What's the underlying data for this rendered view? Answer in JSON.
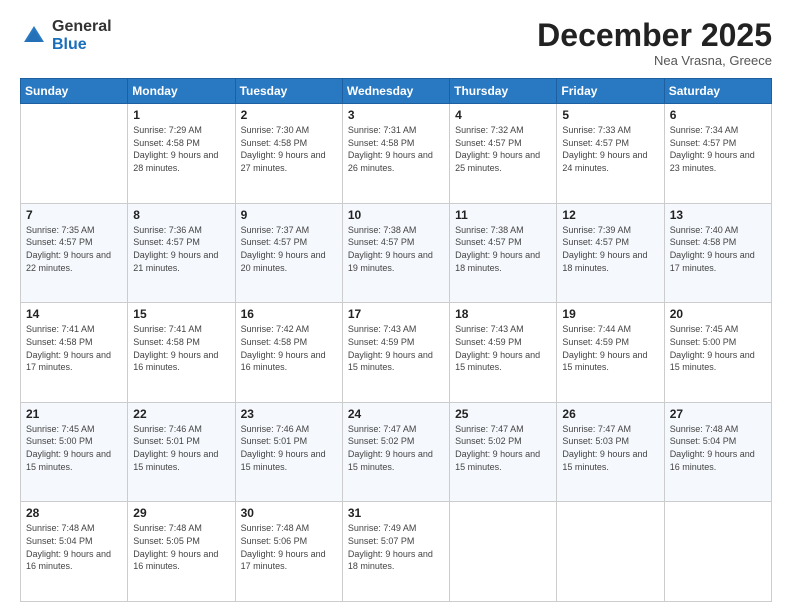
{
  "logo": {
    "general": "General",
    "blue": "Blue"
  },
  "header": {
    "month": "December 2025",
    "location": "Nea Vrasna, Greece"
  },
  "weekdays": [
    "Sunday",
    "Monday",
    "Tuesday",
    "Wednesday",
    "Thursday",
    "Friday",
    "Saturday"
  ],
  "weeks": [
    [
      {
        "day": "",
        "sunrise": "",
        "sunset": "",
        "daylight": ""
      },
      {
        "day": "1",
        "sunrise": "Sunrise: 7:29 AM",
        "sunset": "Sunset: 4:58 PM",
        "daylight": "Daylight: 9 hours and 28 minutes."
      },
      {
        "day": "2",
        "sunrise": "Sunrise: 7:30 AM",
        "sunset": "Sunset: 4:58 PM",
        "daylight": "Daylight: 9 hours and 27 minutes."
      },
      {
        "day": "3",
        "sunrise": "Sunrise: 7:31 AM",
        "sunset": "Sunset: 4:58 PM",
        "daylight": "Daylight: 9 hours and 26 minutes."
      },
      {
        "day": "4",
        "sunrise": "Sunrise: 7:32 AM",
        "sunset": "Sunset: 4:57 PM",
        "daylight": "Daylight: 9 hours and 25 minutes."
      },
      {
        "day": "5",
        "sunrise": "Sunrise: 7:33 AM",
        "sunset": "Sunset: 4:57 PM",
        "daylight": "Daylight: 9 hours and 24 minutes."
      },
      {
        "day": "6",
        "sunrise": "Sunrise: 7:34 AM",
        "sunset": "Sunset: 4:57 PM",
        "daylight": "Daylight: 9 hours and 23 minutes."
      }
    ],
    [
      {
        "day": "7",
        "sunrise": "Sunrise: 7:35 AM",
        "sunset": "Sunset: 4:57 PM",
        "daylight": "Daylight: 9 hours and 22 minutes."
      },
      {
        "day": "8",
        "sunrise": "Sunrise: 7:36 AM",
        "sunset": "Sunset: 4:57 PM",
        "daylight": "Daylight: 9 hours and 21 minutes."
      },
      {
        "day": "9",
        "sunrise": "Sunrise: 7:37 AM",
        "sunset": "Sunset: 4:57 PM",
        "daylight": "Daylight: 9 hours and 20 minutes."
      },
      {
        "day": "10",
        "sunrise": "Sunrise: 7:38 AM",
        "sunset": "Sunset: 4:57 PM",
        "daylight": "Daylight: 9 hours and 19 minutes."
      },
      {
        "day": "11",
        "sunrise": "Sunrise: 7:38 AM",
        "sunset": "Sunset: 4:57 PM",
        "daylight": "Daylight: 9 hours and 18 minutes."
      },
      {
        "day": "12",
        "sunrise": "Sunrise: 7:39 AM",
        "sunset": "Sunset: 4:57 PM",
        "daylight": "Daylight: 9 hours and 18 minutes."
      },
      {
        "day": "13",
        "sunrise": "Sunrise: 7:40 AM",
        "sunset": "Sunset: 4:58 PM",
        "daylight": "Daylight: 9 hours and 17 minutes."
      }
    ],
    [
      {
        "day": "14",
        "sunrise": "Sunrise: 7:41 AM",
        "sunset": "Sunset: 4:58 PM",
        "daylight": "Daylight: 9 hours and 17 minutes."
      },
      {
        "day": "15",
        "sunrise": "Sunrise: 7:41 AM",
        "sunset": "Sunset: 4:58 PM",
        "daylight": "Daylight: 9 hours and 16 minutes."
      },
      {
        "day": "16",
        "sunrise": "Sunrise: 7:42 AM",
        "sunset": "Sunset: 4:58 PM",
        "daylight": "Daylight: 9 hours and 16 minutes."
      },
      {
        "day": "17",
        "sunrise": "Sunrise: 7:43 AM",
        "sunset": "Sunset: 4:59 PM",
        "daylight": "Daylight: 9 hours and 15 minutes."
      },
      {
        "day": "18",
        "sunrise": "Sunrise: 7:43 AM",
        "sunset": "Sunset: 4:59 PM",
        "daylight": "Daylight: 9 hours and 15 minutes."
      },
      {
        "day": "19",
        "sunrise": "Sunrise: 7:44 AM",
        "sunset": "Sunset: 4:59 PM",
        "daylight": "Daylight: 9 hours and 15 minutes."
      },
      {
        "day": "20",
        "sunrise": "Sunrise: 7:45 AM",
        "sunset": "Sunset: 5:00 PM",
        "daylight": "Daylight: 9 hours and 15 minutes."
      }
    ],
    [
      {
        "day": "21",
        "sunrise": "Sunrise: 7:45 AM",
        "sunset": "Sunset: 5:00 PM",
        "daylight": "Daylight: 9 hours and 15 minutes."
      },
      {
        "day": "22",
        "sunrise": "Sunrise: 7:46 AM",
        "sunset": "Sunset: 5:01 PM",
        "daylight": "Daylight: 9 hours and 15 minutes."
      },
      {
        "day": "23",
        "sunrise": "Sunrise: 7:46 AM",
        "sunset": "Sunset: 5:01 PM",
        "daylight": "Daylight: 9 hours and 15 minutes."
      },
      {
        "day": "24",
        "sunrise": "Sunrise: 7:47 AM",
        "sunset": "Sunset: 5:02 PM",
        "daylight": "Daylight: 9 hours and 15 minutes."
      },
      {
        "day": "25",
        "sunrise": "Sunrise: 7:47 AM",
        "sunset": "Sunset: 5:02 PM",
        "daylight": "Daylight: 9 hours and 15 minutes."
      },
      {
        "day": "26",
        "sunrise": "Sunrise: 7:47 AM",
        "sunset": "Sunset: 5:03 PM",
        "daylight": "Daylight: 9 hours and 15 minutes."
      },
      {
        "day": "27",
        "sunrise": "Sunrise: 7:48 AM",
        "sunset": "Sunset: 5:04 PM",
        "daylight": "Daylight: 9 hours and 16 minutes."
      }
    ],
    [
      {
        "day": "28",
        "sunrise": "Sunrise: 7:48 AM",
        "sunset": "Sunset: 5:04 PM",
        "daylight": "Daylight: 9 hours and 16 minutes."
      },
      {
        "day": "29",
        "sunrise": "Sunrise: 7:48 AM",
        "sunset": "Sunset: 5:05 PM",
        "daylight": "Daylight: 9 hours and 16 minutes."
      },
      {
        "day": "30",
        "sunrise": "Sunrise: 7:48 AM",
        "sunset": "Sunset: 5:06 PM",
        "daylight": "Daylight: 9 hours and 17 minutes."
      },
      {
        "day": "31",
        "sunrise": "Sunrise: 7:49 AM",
        "sunset": "Sunset: 5:07 PM",
        "daylight": "Daylight: 9 hours and 18 minutes."
      },
      {
        "day": "",
        "sunrise": "",
        "sunset": "",
        "daylight": ""
      },
      {
        "day": "",
        "sunrise": "",
        "sunset": "",
        "daylight": ""
      },
      {
        "day": "",
        "sunrise": "",
        "sunset": "",
        "daylight": ""
      }
    ]
  ]
}
